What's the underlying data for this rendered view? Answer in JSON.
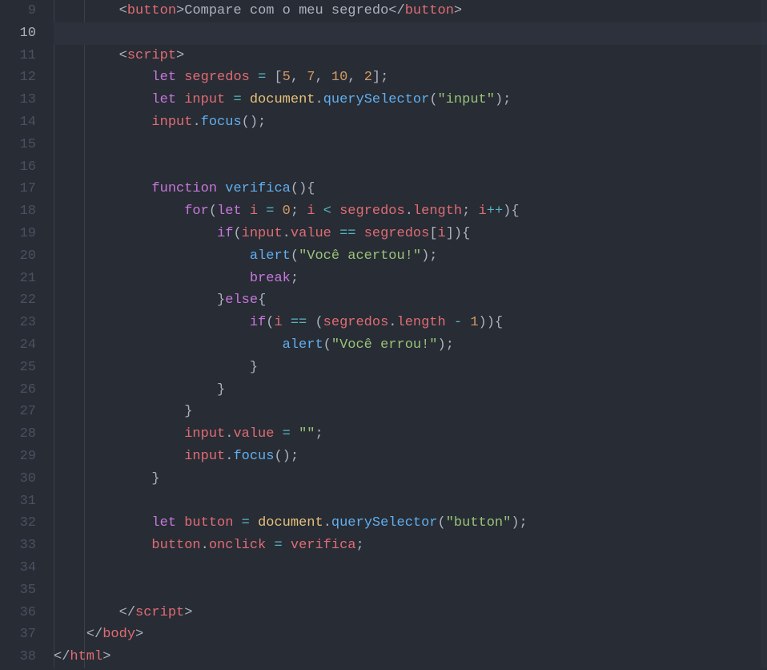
{
  "editor": {
    "line_numbers": [
      "9",
      "10",
      "11",
      "12",
      "13",
      "14",
      "15",
      "16",
      "17",
      "18",
      "19",
      "20",
      "21",
      "22",
      "23",
      "24",
      "25",
      "26",
      "27",
      "28",
      "29",
      "30",
      "31",
      "32",
      "33",
      "34",
      "35",
      "36",
      "37",
      "38"
    ],
    "active_line_index": 1,
    "lines": [
      {
        "indent": "        ",
        "tokens": [
          {
            "t": "angle",
            "v": "<"
          },
          {
            "t": "tag",
            "v": "button"
          },
          {
            "t": "angle",
            "v": ">"
          },
          {
            "t": "text",
            "v": "Compare com o meu segredo"
          },
          {
            "t": "angle",
            "v": "</"
          },
          {
            "t": "tag",
            "v": "button"
          },
          {
            "t": "angle",
            "v": ">"
          }
        ]
      },
      {
        "indent": "",
        "tokens": []
      },
      {
        "indent": "        ",
        "tokens": [
          {
            "t": "angle",
            "v": "<"
          },
          {
            "t": "tag",
            "v": "script"
          },
          {
            "t": "angle",
            "v": ">"
          }
        ]
      },
      {
        "indent": "            ",
        "tokens": [
          {
            "t": "kw",
            "v": "let"
          },
          {
            "t": "text",
            "v": " "
          },
          {
            "t": "var",
            "v": "segredos"
          },
          {
            "t": "text",
            "v": " "
          },
          {
            "t": "op",
            "v": "="
          },
          {
            "t": "text",
            "v": " ["
          },
          {
            "t": "num",
            "v": "5"
          },
          {
            "t": "text",
            "v": ", "
          },
          {
            "t": "num",
            "v": "7"
          },
          {
            "t": "text",
            "v": ", "
          },
          {
            "t": "num",
            "v": "10"
          },
          {
            "t": "text",
            "v": ", "
          },
          {
            "t": "num",
            "v": "2"
          },
          {
            "t": "text",
            "v": "];"
          }
        ]
      },
      {
        "indent": "            ",
        "tokens": [
          {
            "t": "kw",
            "v": "let"
          },
          {
            "t": "text",
            "v": " "
          },
          {
            "t": "var",
            "v": "input"
          },
          {
            "t": "text",
            "v": " "
          },
          {
            "t": "op",
            "v": "="
          },
          {
            "t": "text",
            "v": " "
          },
          {
            "t": "varp",
            "v": "document"
          },
          {
            "t": "text",
            "v": "."
          },
          {
            "t": "fn",
            "v": "querySelector"
          },
          {
            "t": "text",
            "v": "("
          },
          {
            "t": "str",
            "v": "\"input\""
          },
          {
            "t": "text",
            "v": ");"
          }
        ]
      },
      {
        "indent": "            ",
        "tokens": [
          {
            "t": "var",
            "v": "input"
          },
          {
            "t": "text",
            "v": "."
          },
          {
            "t": "fn",
            "v": "focus"
          },
          {
            "t": "text",
            "v": "();"
          }
        ]
      },
      {
        "indent": "",
        "tokens": []
      },
      {
        "indent": "",
        "tokens": []
      },
      {
        "indent": "            ",
        "tokens": [
          {
            "t": "kw",
            "v": "function"
          },
          {
            "t": "text",
            "v": " "
          },
          {
            "t": "fn",
            "v": "verifica"
          },
          {
            "t": "text",
            "v": "(){"
          }
        ]
      },
      {
        "indent": "                ",
        "tokens": [
          {
            "t": "kw",
            "v": "for"
          },
          {
            "t": "text",
            "v": "("
          },
          {
            "t": "kw",
            "v": "let"
          },
          {
            "t": "text",
            "v": " "
          },
          {
            "t": "var",
            "v": "i"
          },
          {
            "t": "text",
            "v": " "
          },
          {
            "t": "op",
            "v": "="
          },
          {
            "t": "text",
            "v": " "
          },
          {
            "t": "num",
            "v": "0"
          },
          {
            "t": "text",
            "v": "; "
          },
          {
            "t": "var",
            "v": "i"
          },
          {
            "t": "text",
            "v": " "
          },
          {
            "t": "op",
            "v": "<"
          },
          {
            "t": "text",
            "v": " "
          },
          {
            "t": "var",
            "v": "segredos"
          },
          {
            "t": "text",
            "v": "."
          },
          {
            "t": "prop",
            "v": "length"
          },
          {
            "t": "text",
            "v": "; "
          },
          {
            "t": "var",
            "v": "i"
          },
          {
            "t": "op",
            "v": "++"
          },
          {
            "t": "text",
            "v": "){"
          }
        ]
      },
      {
        "indent": "                    ",
        "tokens": [
          {
            "t": "kw",
            "v": "if"
          },
          {
            "t": "text",
            "v": "("
          },
          {
            "t": "var",
            "v": "input"
          },
          {
            "t": "text",
            "v": "."
          },
          {
            "t": "prop",
            "v": "value"
          },
          {
            "t": "text",
            "v": " "
          },
          {
            "t": "op",
            "v": "=="
          },
          {
            "t": "text",
            "v": " "
          },
          {
            "t": "var",
            "v": "segredos"
          },
          {
            "t": "text",
            "v": "["
          },
          {
            "t": "var",
            "v": "i"
          },
          {
            "t": "text",
            "v": "]){"
          }
        ]
      },
      {
        "indent": "                        ",
        "tokens": [
          {
            "t": "fn",
            "v": "alert"
          },
          {
            "t": "text",
            "v": "("
          },
          {
            "t": "str",
            "v": "\"Você acertou!\""
          },
          {
            "t": "text",
            "v": ");"
          }
        ]
      },
      {
        "indent": "                        ",
        "tokens": [
          {
            "t": "kw",
            "v": "break"
          },
          {
            "t": "text",
            "v": ";"
          }
        ]
      },
      {
        "indent": "                    ",
        "tokens": [
          {
            "t": "text",
            "v": "}"
          },
          {
            "t": "kw",
            "v": "else"
          },
          {
            "t": "text",
            "v": "{"
          }
        ]
      },
      {
        "indent": "                        ",
        "tokens": [
          {
            "t": "kw",
            "v": "if"
          },
          {
            "t": "text",
            "v": "("
          },
          {
            "t": "var",
            "v": "i"
          },
          {
            "t": "text",
            "v": " "
          },
          {
            "t": "op",
            "v": "=="
          },
          {
            "t": "text",
            "v": " ("
          },
          {
            "t": "var",
            "v": "segredos"
          },
          {
            "t": "text",
            "v": "."
          },
          {
            "t": "prop",
            "v": "length"
          },
          {
            "t": "text",
            "v": " "
          },
          {
            "t": "op",
            "v": "-"
          },
          {
            "t": "text",
            "v": " "
          },
          {
            "t": "num",
            "v": "1"
          },
          {
            "t": "text",
            "v": ")){"
          }
        ]
      },
      {
        "indent": "                            ",
        "tokens": [
          {
            "t": "fn",
            "v": "alert"
          },
          {
            "t": "text",
            "v": "("
          },
          {
            "t": "str",
            "v": "\"Você errou!\""
          },
          {
            "t": "text",
            "v": ");"
          }
        ]
      },
      {
        "indent": "                        ",
        "tokens": [
          {
            "t": "text",
            "v": "}"
          }
        ]
      },
      {
        "indent": "                    ",
        "tokens": [
          {
            "t": "text",
            "v": "}"
          }
        ]
      },
      {
        "indent": "                ",
        "tokens": [
          {
            "t": "text",
            "v": "}"
          }
        ]
      },
      {
        "indent": "                ",
        "tokens": [
          {
            "t": "var",
            "v": "input"
          },
          {
            "t": "text",
            "v": "."
          },
          {
            "t": "prop",
            "v": "value"
          },
          {
            "t": "text",
            "v": " "
          },
          {
            "t": "op",
            "v": "="
          },
          {
            "t": "text",
            "v": " "
          },
          {
            "t": "str",
            "v": "\"\""
          },
          {
            "t": "text",
            "v": ";"
          }
        ]
      },
      {
        "indent": "                ",
        "tokens": [
          {
            "t": "var",
            "v": "input"
          },
          {
            "t": "text",
            "v": "."
          },
          {
            "t": "fn",
            "v": "focus"
          },
          {
            "t": "text",
            "v": "();"
          }
        ]
      },
      {
        "indent": "            ",
        "tokens": [
          {
            "t": "text",
            "v": "}"
          }
        ]
      },
      {
        "indent": "",
        "tokens": []
      },
      {
        "indent": "            ",
        "tokens": [
          {
            "t": "kw",
            "v": "let"
          },
          {
            "t": "text",
            "v": " "
          },
          {
            "t": "var",
            "v": "button"
          },
          {
            "t": "text",
            "v": " "
          },
          {
            "t": "op",
            "v": "="
          },
          {
            "t": "text",
            "v": " "
          },
          {
            "t": "varp",
            "v": "document"
          },
          {
            "t": "text",
            "v": "."
          },
          {
            "t": "fn",
            "v": "querySelector"
          },
          {
            "t": "text",
            "v": "("
          },
          {
            "t": "str",
            "v": "\"button\""
          },
          {
            "t": "text",
            "v": ");"
          }
        ]
      },
      {
        "indent": "            ",
        "tokens": [
          {
            "t": "var",
            "v": "button"
          },
          {
            "t": "text",
            "v": "."
          },
          {
            "t": "prop",
            "v": "onclick"
          },
          {
            "t": "text",
            "v": " "
          },
          {
            "t": "op",
            "v": "="
          },
          {
            "t": "text",
            "v": " "
          },
          {
            "t": "var",
            "v": "verifica"
          },
          {
            "t": "text",
            "v": ";"
          }
        ]
      },
      {
        "indent": "",
        "tokens": []
      },
      {
        "indent": "",
        "tokens": []
      },
      {
        "indent": "        ",
        "tokens": [
          {
            "t": "angle",
            "v": "</"
          },
          {
            "t": "tag",
            "v": "script"
          },
          {
            "t": "angle",
            "v": ">"
          }
        ]
      },
      {
        "indent": "    ",
        "tokens": [
          {
            "t": "angle",
            "v": "</"
          },
          {
            "t": "tag",
            "v": "body"
          },
          {
            "t": "angle",
            "v": ">"
          }
        ]
      },
      {
        "indent": "",
        "tokens": [
          {
            "t": "angle",
            "v": "</"
          },
          {
            "t": "tag",
            "v": "html"
          },
          {
            "t": "angle",
            "v": ">"
          }
        ]
      }
    ]
  },
  "token_class_map": {
    "angle": "t-punc",
    "tag": "t-tag",
    "text": "t-punc",
    "kw": "t-kw",
    "var": "t-var",
    "varp": "t-varp",
    "num": "t-num",
    "str": "t-str",
    "fn": "t-fn",
    "op": "t-op",
    "prop": "t-prop"
  }
}
